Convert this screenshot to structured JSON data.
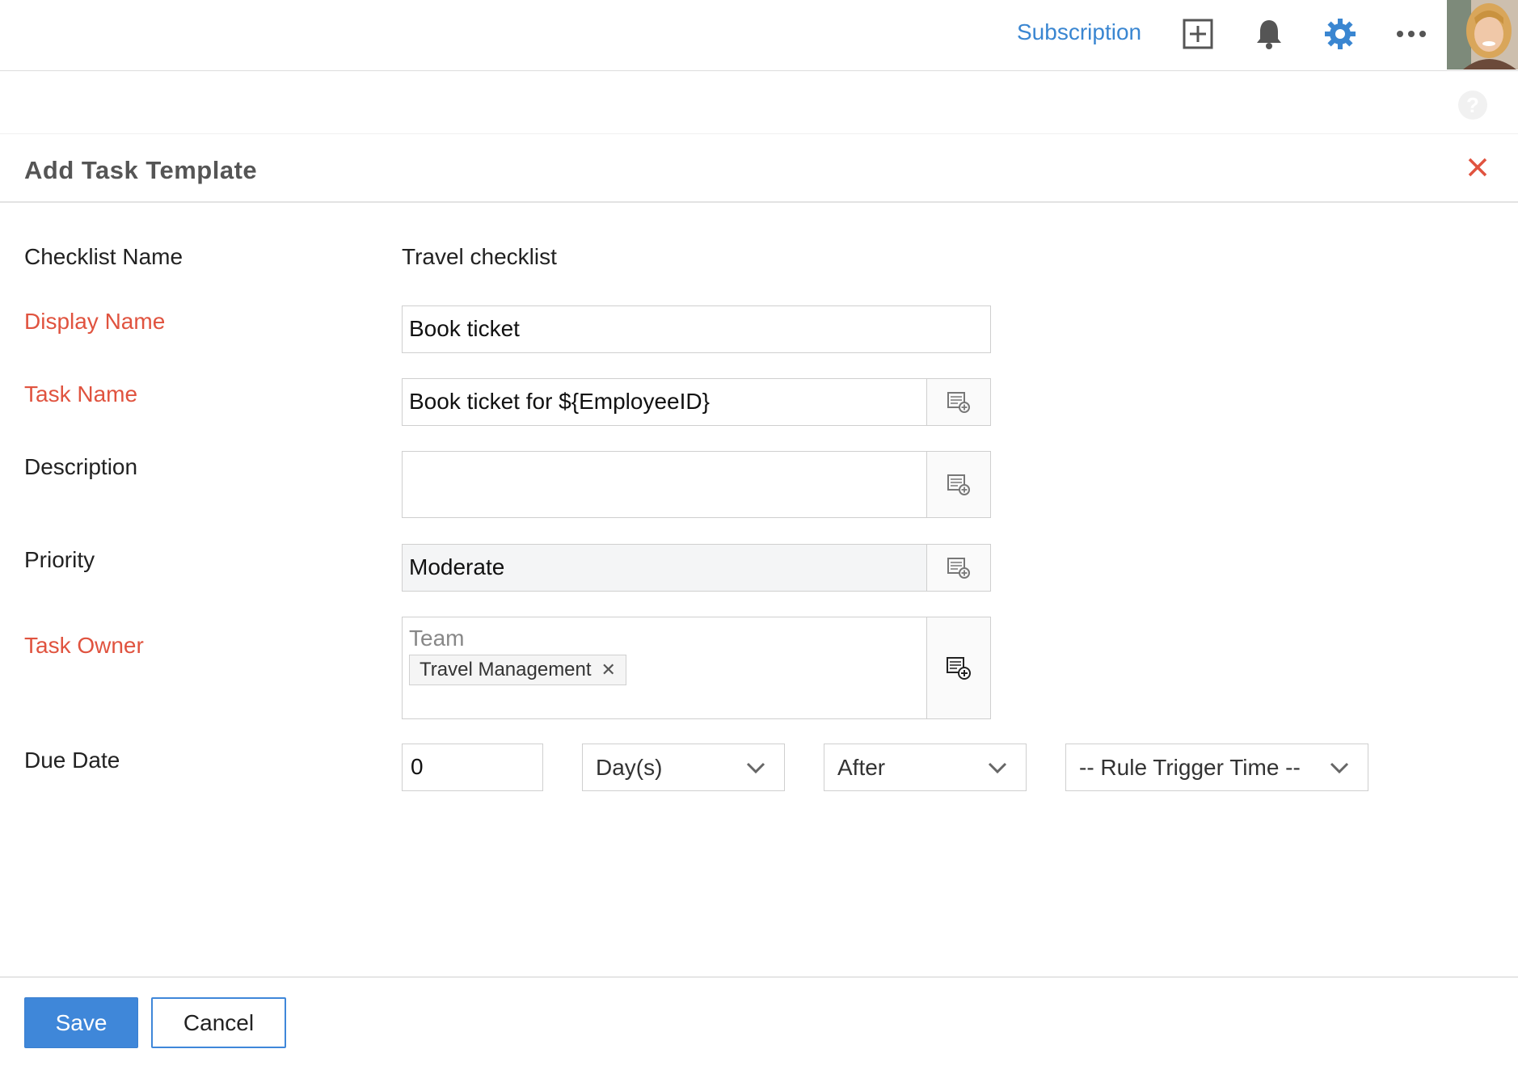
{
  "topbar": {
    "subscription_label": "Subscription",
    "icons": [
      "add-icon",
      "bell-icon",
      "gear-icon",
      "more-icon"
    ],
    "accent_color": "#3a86d1"
  },
  "dialog": {
    "title": "Add Task Template",
    "close_color": "#e0533f"
  },
  "form": {
    "checklist_name": {
      "label": "Checklist Name",
      "value": "Travel checklist"
    },
    "display_name": {
      "label": "Display Name",
      "value": "Book ticket",
      "required": true
    },
    "task_name": {
      "label": "Task Name",
      "value": "Book ticket for ${EmployeeID}",
      "required": true
    },
    "description": {
      "label": "Description",
      "value": ""
    },
    "priority": {
      "label": "Priority",
      "value": "Moderate"
    },
    "task_owner": {
      "label": "Task Owner",
      "placeholder": "Team",
      "selected": [
        "Travel Management"
      ],
      "required": true
    },
    "due_date": {
      "label": "Due Date",
      "amount": "0",
      "unit": "Day(s)",
      "direction": "After",
      "trigger": "-- Rule Trigger Time --"
    }
  },
  "footer": {
    "save_label": "Save",
    "cancel_label": "Cancel"
  },
  "colors": {
    "required_label": "#e0533f",
    "primary_button": "#3f87d9"
  }
}
